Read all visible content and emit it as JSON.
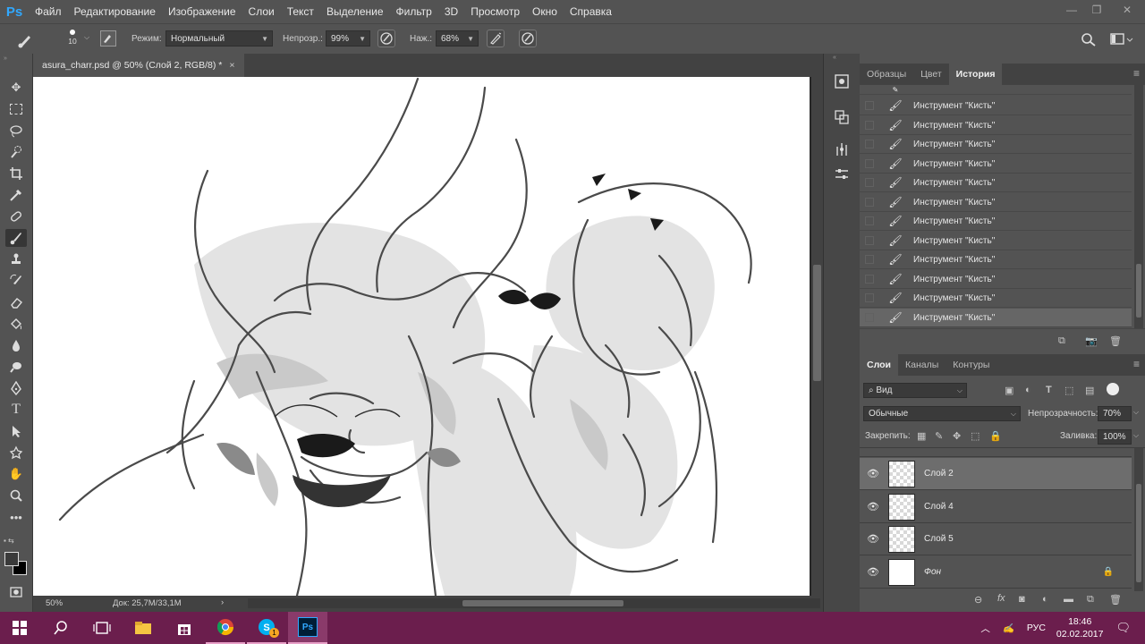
{
  "app": {
    "logo": "Ps",
    "name": "Adobe Photoshop"
  },
  "menu": [
    "Файл",
    "Редактирование",
    "Изображение",
    "Слои",
    "Текст",
    "Выделение",
    "Фильтр",
    "3D",
    "Просмотр",
    "Окно",
    "Справка"
  ],
  "window_controls": {
    "minimize": "—",
    "maximize": "❐",
    "close": "✕"
  },
  "options": {
    "brush_size": "10",
    "mode_label": "Режим:",
    "mode_value": "Нормальный",
    "opacity_label": "Непрозр.:",
    "opacity_value": "99%",
    "pressure_label": "Наж.:",
    "pressure_value": "68%"
  },
  "document": {
    "tab_title": "asura_charr.psd @ 50% (Слой 2, RGB/8) *",
    "close": "×"
  },
  "status": {
    "zoom": "50%",
    "doc_info": "Док: 25,7M/33,1M",
    "arrow": "›"
  },
  "tools": [
    "move-tool",
    "marquee-tool",
    "lasso-tool",
    "quick-select-tool",
    "crop-tool",
    "eyedropper-tool",
    "healing-tool",
    "brush-tool",
    "stamp-tool",
    "history-brush-tool",
    "eraser-tool",
    "gradient-tool",
    "blur-tool",
    "dodge-tool",
    "pen-tool",
    "type-tool",
    "path-select-tool",
    "shape-tool",
    "hand-tool",
    "zoom-tool",
    "more-tools"
  ],
  "history_panel": {
    "tabs": [
      "Образцы",
      "Цвет",
      "История"
    ],
    "active_tab": "История",
    "items": [
      "Инструмент \"Кисть\"",
      "Инструмент \"Кисть\"",
      "Инструмент \"Кисть\"",
      "Инструмент \"Кисть\"",
      "Инструмент \"Кисть\"",
      "Инструмент \"Кисть\"",
      "Инструмент \"Кисть\"",
      "Инструмент \"Кисть\"",
      "Инструмент \"Кисть\"",
      "Инструмент \"Кисть\"",
      "Инструмент \"Кисть\"",
      "Инструмент \"Кисть\""
    ],
    "selected_index": 11
  },
  "layers_panel": {
    "tabs": [
      "Слои",
      "Каналы",
      "Контуры"
    ],
    "active_tab": "Слои",
    "filter_label": "Вид",
    "blend_mode": "Обычные",
    "opacity_label": "Непрозрачность:",
    "opacity_value": "70%",
    "lock_label": "Закрепить:",
    "fill_label": "Заливка:",
    "fill_value": "100%",
    "layers": [
      {
        "name": "Слой 2",
        "selected": true,
        "locked": false
      },
      {
        "name": "Слой 4",
        "selected": false,
        "locked": false
      },
      {
        "name": "Слой 5",
        "selected": false,
        "locked": false
      },
      {
        "name": "Фон",
        "selected": false,
        "locked": true
      }
    ]
  },
  "taskbar": {
    "language": "РУС",
    "time": "18:46",
    "date": "02.02.2017",
    "ps_label": "Ps",
    "skype_badge": "1"
  },
  "colors": {
    "accent": "#31a8ff",
    "taskbar": "#6b1e4d",
    "panel": "#535353",
    "selected_row": "#6d6d6d"
  }
}
